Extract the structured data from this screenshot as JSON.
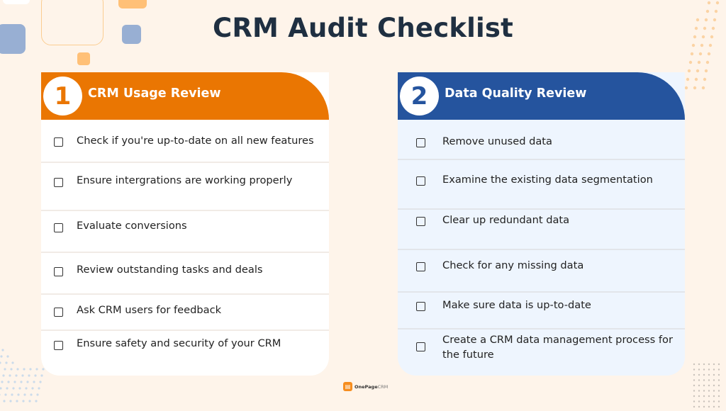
{
  "page": {
    "title": "CRM Audit Checklist",
    "background_color": "#fef4ea"
  },
  "sections": [
    {
      "number": "1",
      "title": "CRM Usage Review",
      "accent_color": "#ea7602",
      "items": [
        "Check if you're up-to-date on all new features",
        "Ensure intergrations are working properly",
        "Evaluate conversions",
        "Review outstanding tasks and deals",
        "Ask CRM users for feedback",
        "Ensure safety and security of your CRM"
      ]
    },
    {
      "number": "2",
      "title": "Data Quality Review",
      "accent_color": "#25549e",
      "items": [
        "Remove unused data",
        "Examine the existing data segmentation",
        "Clear up redundant data",
        "Check for any missing data",
        "Make sure data is up-to-date",
        "Create a CRM data management process for the future"
      ]
    }
  ],
  "footer": {
    "logo_icon": "book-icon",
    "brand_bold": "OnePage",
    "brand_light": "CRM"
  }
}
